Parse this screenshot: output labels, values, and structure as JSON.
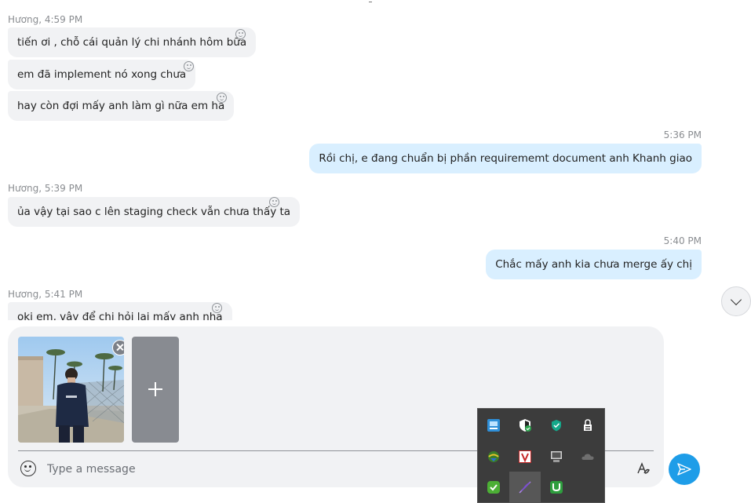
{
  "messages": [
    {
      "sender": "Hương, 4:59 PM"
    },
    {
      "text": "tiến ơi , chỗ cái quản lý chi nhánh hôm bữa"
    },
    {
      "text": "em đã implement nó xong chưa"
    },
    {
      "text": "hay còn đợi mấy anh làm gì nữa em ha"
    },
    {
      "time": "5:36 PM"
    },
    {
      "text": "Rồi chị, e đang chuẩn bị phần requirememt document anh Khanh giao"
    },
    {
      "sender": "Hương, 5:39 PM"
    },
    {
      "text": "ủa vậy tại sao c lên staging check vẫn chưa thấy ta"
    },
    {
      "time": "5:40 PM"
    },
    {
      "text": "Chắc mấy anh kia chưa merge ấy chị"
    },
    {
      "sender": "Hương, 5:41 PM"
    },
    {
      "text": "oki em, vậy để chị hỏi lại mấy anh nha"
    }
  ],
  "composer": {
    "placeholder": "Type a message"
  },
  "colors": {
    "incoming_bubble": "#f1f2f4",
    "outgoing_bubble": "#d9efff",
    "send_button": "#1e9de8",
    "tray_background": "#3c3c3c"
  },
  "tray_icons": [
    "network-monitor-icon",
    "windows-security-icon",
    "antivirus-shield-icon",
    "vpn-lock-icon",
    "download-manager-icon",
    "vivaldi-icon",
    "display-icon",
    "onedrive-cloud-icon",
    "kaspersky-icon",
    "feather-pen-icon",
    "utorrent-icon"
  ]
}
